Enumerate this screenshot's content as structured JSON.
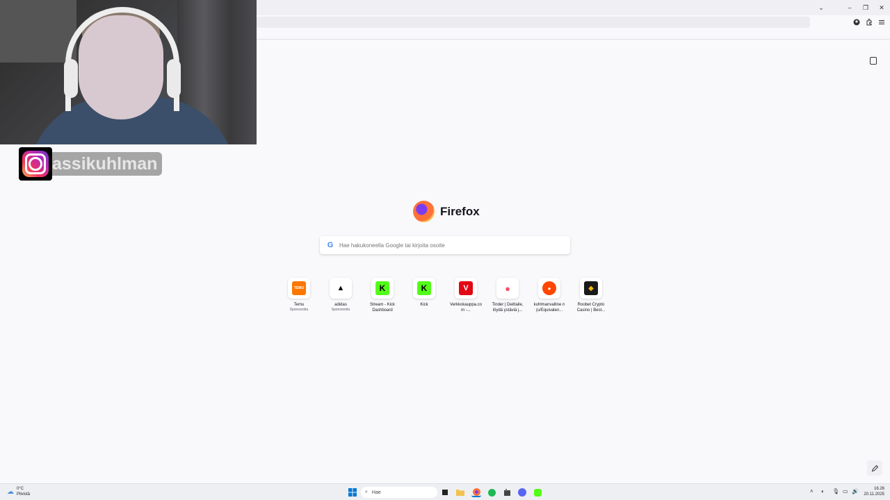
{
  "browser": {
    "window_controls": {
      "dropdown": "⌄",
      "minimize": "–",
      "restore": "❐",
      "close": "✕"
    },
    "toolbar_icons": [
      "account-icon",
      "extensions-icon",
      "menu-icon"
    ]
  },
  "overlay": {
    "instagram_handle": "assikuhlman"
  },
  "newtab": {
    "brand": "Firefox",
    "search_placeholder": "Hae hakukoneella Google tai kirjoita osoite",
    "tiles": [
      {
        "label": "Temu",
        "sponsor": "Sponsoroitu",
        "logo_text": "TEMU",
        "color": "#fb7701"
      },
      {
        "label": "adidas",
        "sponsor": "Sponsoroitu",
        "logo_text": "▲",
        "color": "#ffffff"
      },
      {
        "label": "Stream - Kick Dashboard",
        "sponsor": "",
        "logo_text": "K",
        "color": "#53fc18"
      },
      {
        "label": "Kick",
        "sponsor": "",
        "logo_text": "K",
        "color": "#53fc18"
      },
      {
        "label": "Verkkokauppa.co m -...",
        "sponsor": "",
        "logo_text": "V",
        "color": "#e30613"
      },
      {
        "label": "Tinder | Deittaile, löydä ystäviä j...",
        "sponsor": "",
        "logo_text": "●",
        "color": "#fd5068"
      },
      {
        "label": "kuhlmanvalline n (u/Equivalen...",
        "sponsor": "",
        "logo_text": "●",
        "color": "#ff4500"
      },
      {
        "label": "Roobet Crypto Casino | Best...",
        "sponsor": "",
        "logo_text": "◆",
        "color": "#1a1a1a"
      }
    ]
  },
  "taskbar": {
    "weather_temp": "0°C",
    "weather_desc": "Pilvistä",
    "search_label": "Hae",
    "time": "16.26",
    "date": "20.11.2025"
  }
}
